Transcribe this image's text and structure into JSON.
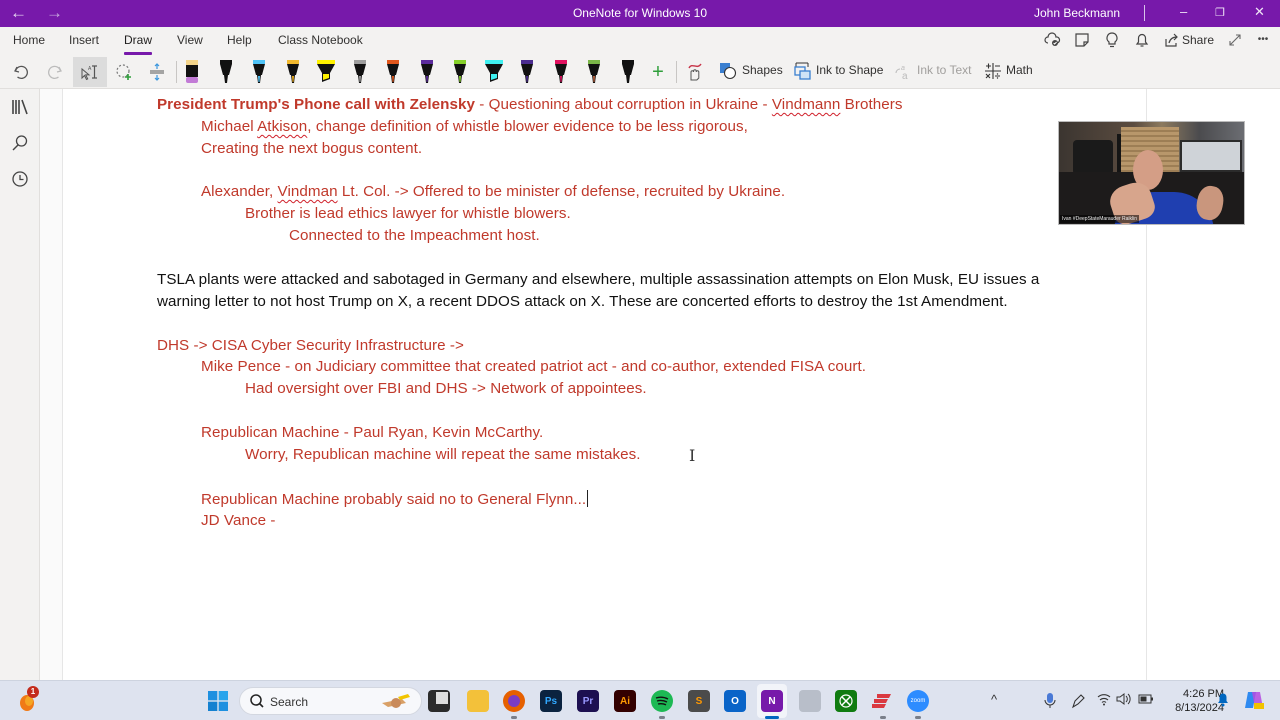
{
  "titlebar": {
    "app_title": "OneNote for Windows 10",
    "user_name": "John Beckmann",
    "back_icon": "arrow-left-icon",
    "forward_icon": "arrow-right-icon",
    "minimize_glyph": "–",
    "restore_glyph": "❐",
    "close_glyph": "✕"
  },
  "ribbon": {
    "tabs": [
      {
        "label": "Home"
      },
      {
        "label": "Insert"
      },
      {
        "label": "Draw",
        "active": true
      },
      {
        "label": "View"
      },
      {
        "label": "Help"
      },
      {
        "label": "Class Notebook"
      }
    ],
    "right_commands": {
      "sync_icon": "cloud-sync-icon",
      "page_icon": "sticky-note-icon",
      "tell_me_icon": "lightbulb-icon",
      "notifications_icon": "bell-icon",
      "share_label": "Share",
      "fullscreen_icon": "expand-icon",
      "more_glyph": "•••"
    },
    "tools": {
      "undo": "undo-icon",
      "redo": "redo-icon",
      "type_select": "type-select-icon",
      "lasso": "lasso-select-icon",
      "insert_space": "insert-space-icon"
    },
    "pens": [
      {
        "name": "eraser",
        "color": "#c27bd6",
        "cap": "#f3d48a",
        "kind": "eraser"
      },
      {
        "name": "pen-black",
        "color": "#111111",
        "cap": "#111111",
        "kind": "pen"
      },
      {
        "name": "pen-light-blue",
        "color": "#4fc3f7",
        "cap": "#4fc3f7",
        "kind": "pen"
      },
      {
        "name": "pen-gold",
        "color": "#e6a817",
        "cap": "#f2b92e",
        "kind": "pen"
      },
      {
        "name": "highlighter-yellow",
        "color": "#fff200",
        "cap": "#fff200",
        "kind": "highlighter"
      },
      {
        "name": "pen-galaxy-silver",
        "color": "#9e9e9e",
        "cap": "#9e9e9e",
        "kind": "pen"
      },
      {
        "name": "pen-orange",
        "color": "#e0561b",
        "cap": "#e0561b",
        "kind": "pen"
      },
      {
        "name": "pen-purple",
        "color": "#5b2b9c",
        "cap": "#5b2b9c",
        "kind": "pen"
      },
      {
        "name": "pen-lime",
        "color": "#86d12a",
        "cap": "#86d12a",
        "kind": "pen"
      },
      {
        "name": "highlighter-cyan",
        "color": "#3ff0f0",
        "cap": "#3ff0f0",
        "kind": "highlighter"
      },
      {
        "name": "pen-indigo",
        "color": "#4b2c8f",
        "cap": "#4b2c8f",
        "kind": "pen"
      },
      {
        "name": "pen-magenta",
        "color": "#e0115f",
        "cap": "#e0115f",
        "kind": "pen"
      },
      {
        "name": "pen-rainbow",
        "color": "#b8603c",
        "cap": "#7ab648",
        "kind": "pen"
      },
      {
        "name": "pen-black-2",
        "color": "#111111",
        "cap": "#111111",
        "kind": "pen"
      }
    ],
    "add_pen_icon": "plus-icon",
    "commands": [
      {
        "label": "Shapes",
        "icon": "shapes-icon",
        "disabled": false
      },
      {
        "label": "Ink to Shape",
        "icon": "ink-to-shape-icon",
        "disabled": false
      },
      {
        "label": "Ink to Text",
        "icon": "ink-to-text-icon",
        "disabled": true
      },
      {
        "label": "Math",
        "icon": "math-icon",
        "disabled": false
      }
    ]
  },
  "left_rail": {
    "items": [
      {
        "icon": "notebooks-icon"
      },
      {
        "icon": "search-icon"
      },
      {
        "icon": "recent-clock-icon"
      }
    ]
  },
  "note": {
    "lines": [
      {
        "bold": "President Trump's Phone call with Zelensky",
        "rest_a": " - Questioning about corruption in Ukraine - ",
        "misspelled": "Vindmann",
        "rest_b": " Brothers"
      },
      {
        "pre": "Michael ",
        "misspelled": "Atkison",
        "post": ", change definition of whistle blower evidence to be less rigorous,"
      },
      {
        "text": "Creating the next bogus content."
      },
      {
        "pre": "Alexander, ",
        "misspelled": "Vindman",
        "post": " Lt. Col. -> Offered to be minister of defense, recruited by Ukraine."
      },
      {
        "text": "Brother is lead ethics lawyer for whistle blowers."
      },
      {
        "text": "Connected to the Impeachment host."
      },
      {
        "text": "TSLA plants were attacked and sabotaged in Germany and elsewhere, multiple assassination attempts on Elon Musk, EU issues a"
      },
      {
        "text": "warning letter to not host Trump on X, a recent DDOS attack on X. These are concerted efforts to destroy the 1st Amendment."
      },
      {
        "text": "DHS -> CISA Cyber Security Infrastructure  ->"
      },
      {
        "text": "Mike Pence - on Judiciary committee that created patriot act - and co-author, extended FISA court."
      },
      {
        "text": "Had oversight over FBI and DHS -> Network of appointees."
      },
      {
        "text": "Republican Machine - Paul Ryan, Kevin McCarthy."
      },
      {
        "text": "Worry, Republican machine will repeat the same mistakes."
      },
      {
        "text": "Republican Machine probably said no to General Flynn..."
      },
      {
        "text": "JD Vance -"
      }
    ],
    "text_colors": {
      "red": "#c0392b",
      "black": "#111111"
    }
  },
  "video_overlay": {
    "participant_label": "Ivan #DeepStateMarauder Raiklin"
  },
  "taskbar": {
    "notification_count": "1",
    "search_placeholder": "Search",
    "apps": [
      {
        "name": "start",
        "icon": "windows-start-icon"
      },
      {
        "name": "task-view",
        "icon": "task-view-icon"
      },
      {
        "name": "file-explorer",
        "icon": "folder-icon"
      },
      {
        "name": "firefox",
        "icon": "firefox-icon"
      },
      {
        "name": "photoshop",
        "label": "Ps",
        "icon": "photoshop-icon"
      },
      {
        "name": "premiere",
        "label": "Pr",
        "icon": "premiere-icon"
      },
      {
        "name": "illustrator",
        "label": "Ai",
        "icon": "illustrator-icon"
      },
      {
        "name": "spotify",
        "icon": "spotify-icon"
      },
      {
        "name": "sublime",
        "label": "S",
        "icon": "sublime-text-icon"
      },
      {
        "name": "outlook",
        "label": "O",
        "icon": "outlook-icon"
      },
      {
        "name": "onenote",
        "label": "N",
        "icon": "onenote-icon"
      },
      {
        "name": "app-gray",
        "icon": "app-icon"
      },
      {
        "name": "xbox",
        "icon": "xbox-icon"
      },
      {
        "name": "expressvpn",
        "icon": "expressvpn-icon"
      },
      {
        "name": "zoom",
        "label": "zoom",
        "icon": "zoom-icon"
      }
    ],
    "tray": {
      "chevron": "^",
      "time": "4:26 PM",
      "date": "8/13/2024"
    }
  }
}
